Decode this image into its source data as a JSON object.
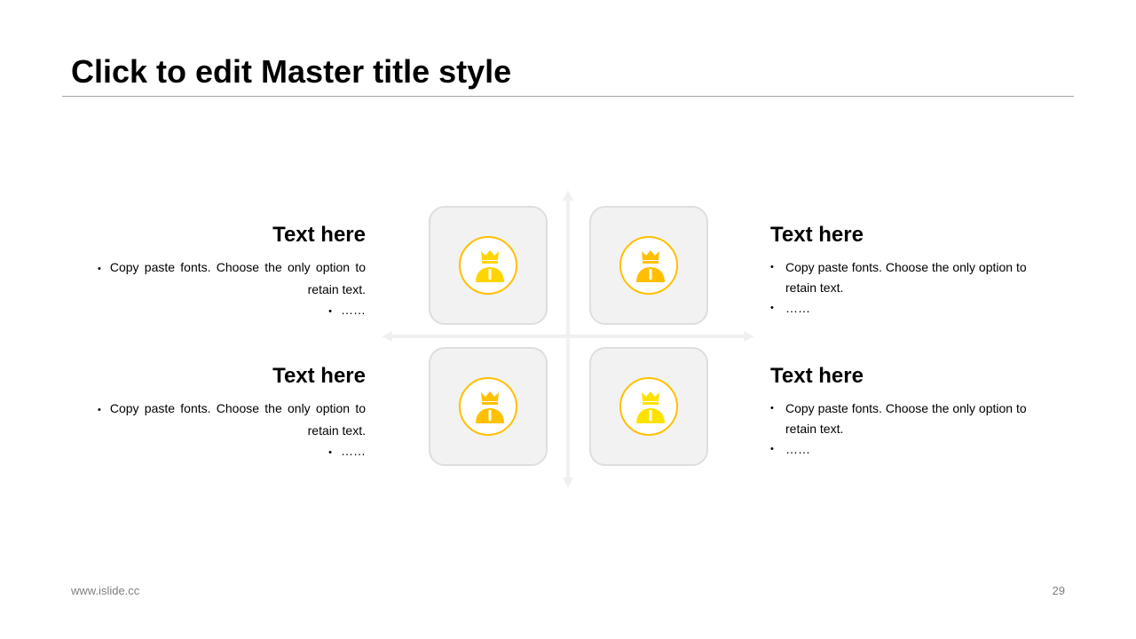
{
  "slide": {
    "title": "Click to edit Master title style",
    "footer_left": "www.islide.cc",
    "page_number": "29"
  },
  "colors": {
    "accent": "#ffc000",
    "accent_light": "#ffd966",
    "tile_fill": "#f2f2f2",
    "tile_border": "#dedede",
    "axis": "#f0f0f0"
  },
  "quadrants": {
    "top_left": {
      "heading": "Text here",
      "bullets": [
        "Copy paste fonts. Choose the only option to retain text.",
        "……"
      ],
      "icon": "king-person-icon",
      "icon_color": "#ffd500"
    },
    "top_right": {
      "heading": "Text here",
      "bullets": [
        "Copy paste fonts. Choose the only option to retain text.",
        "……"
      ],
      "icon": "king-person-icon",
      "icon_color": "#ffbf00"
    },
    "bottom_left": {
      "heading": "Text here",
      "bullets": [
        "Copy paste fonts. Choose the only option to retain text.",
        "……"
      ],
      "icon": "king-person-icon",
      "icon_color": "#ffc000"
    },
    "bottom_right": {
      "heading": "Text here",
      "bullets": [
        "Copy paste fonts. Choose the only option to retain text.",
        "……"
      ],
      "icon": "king-person-icon",
      "icon_color": "#ffe100"
    }
  }
}
